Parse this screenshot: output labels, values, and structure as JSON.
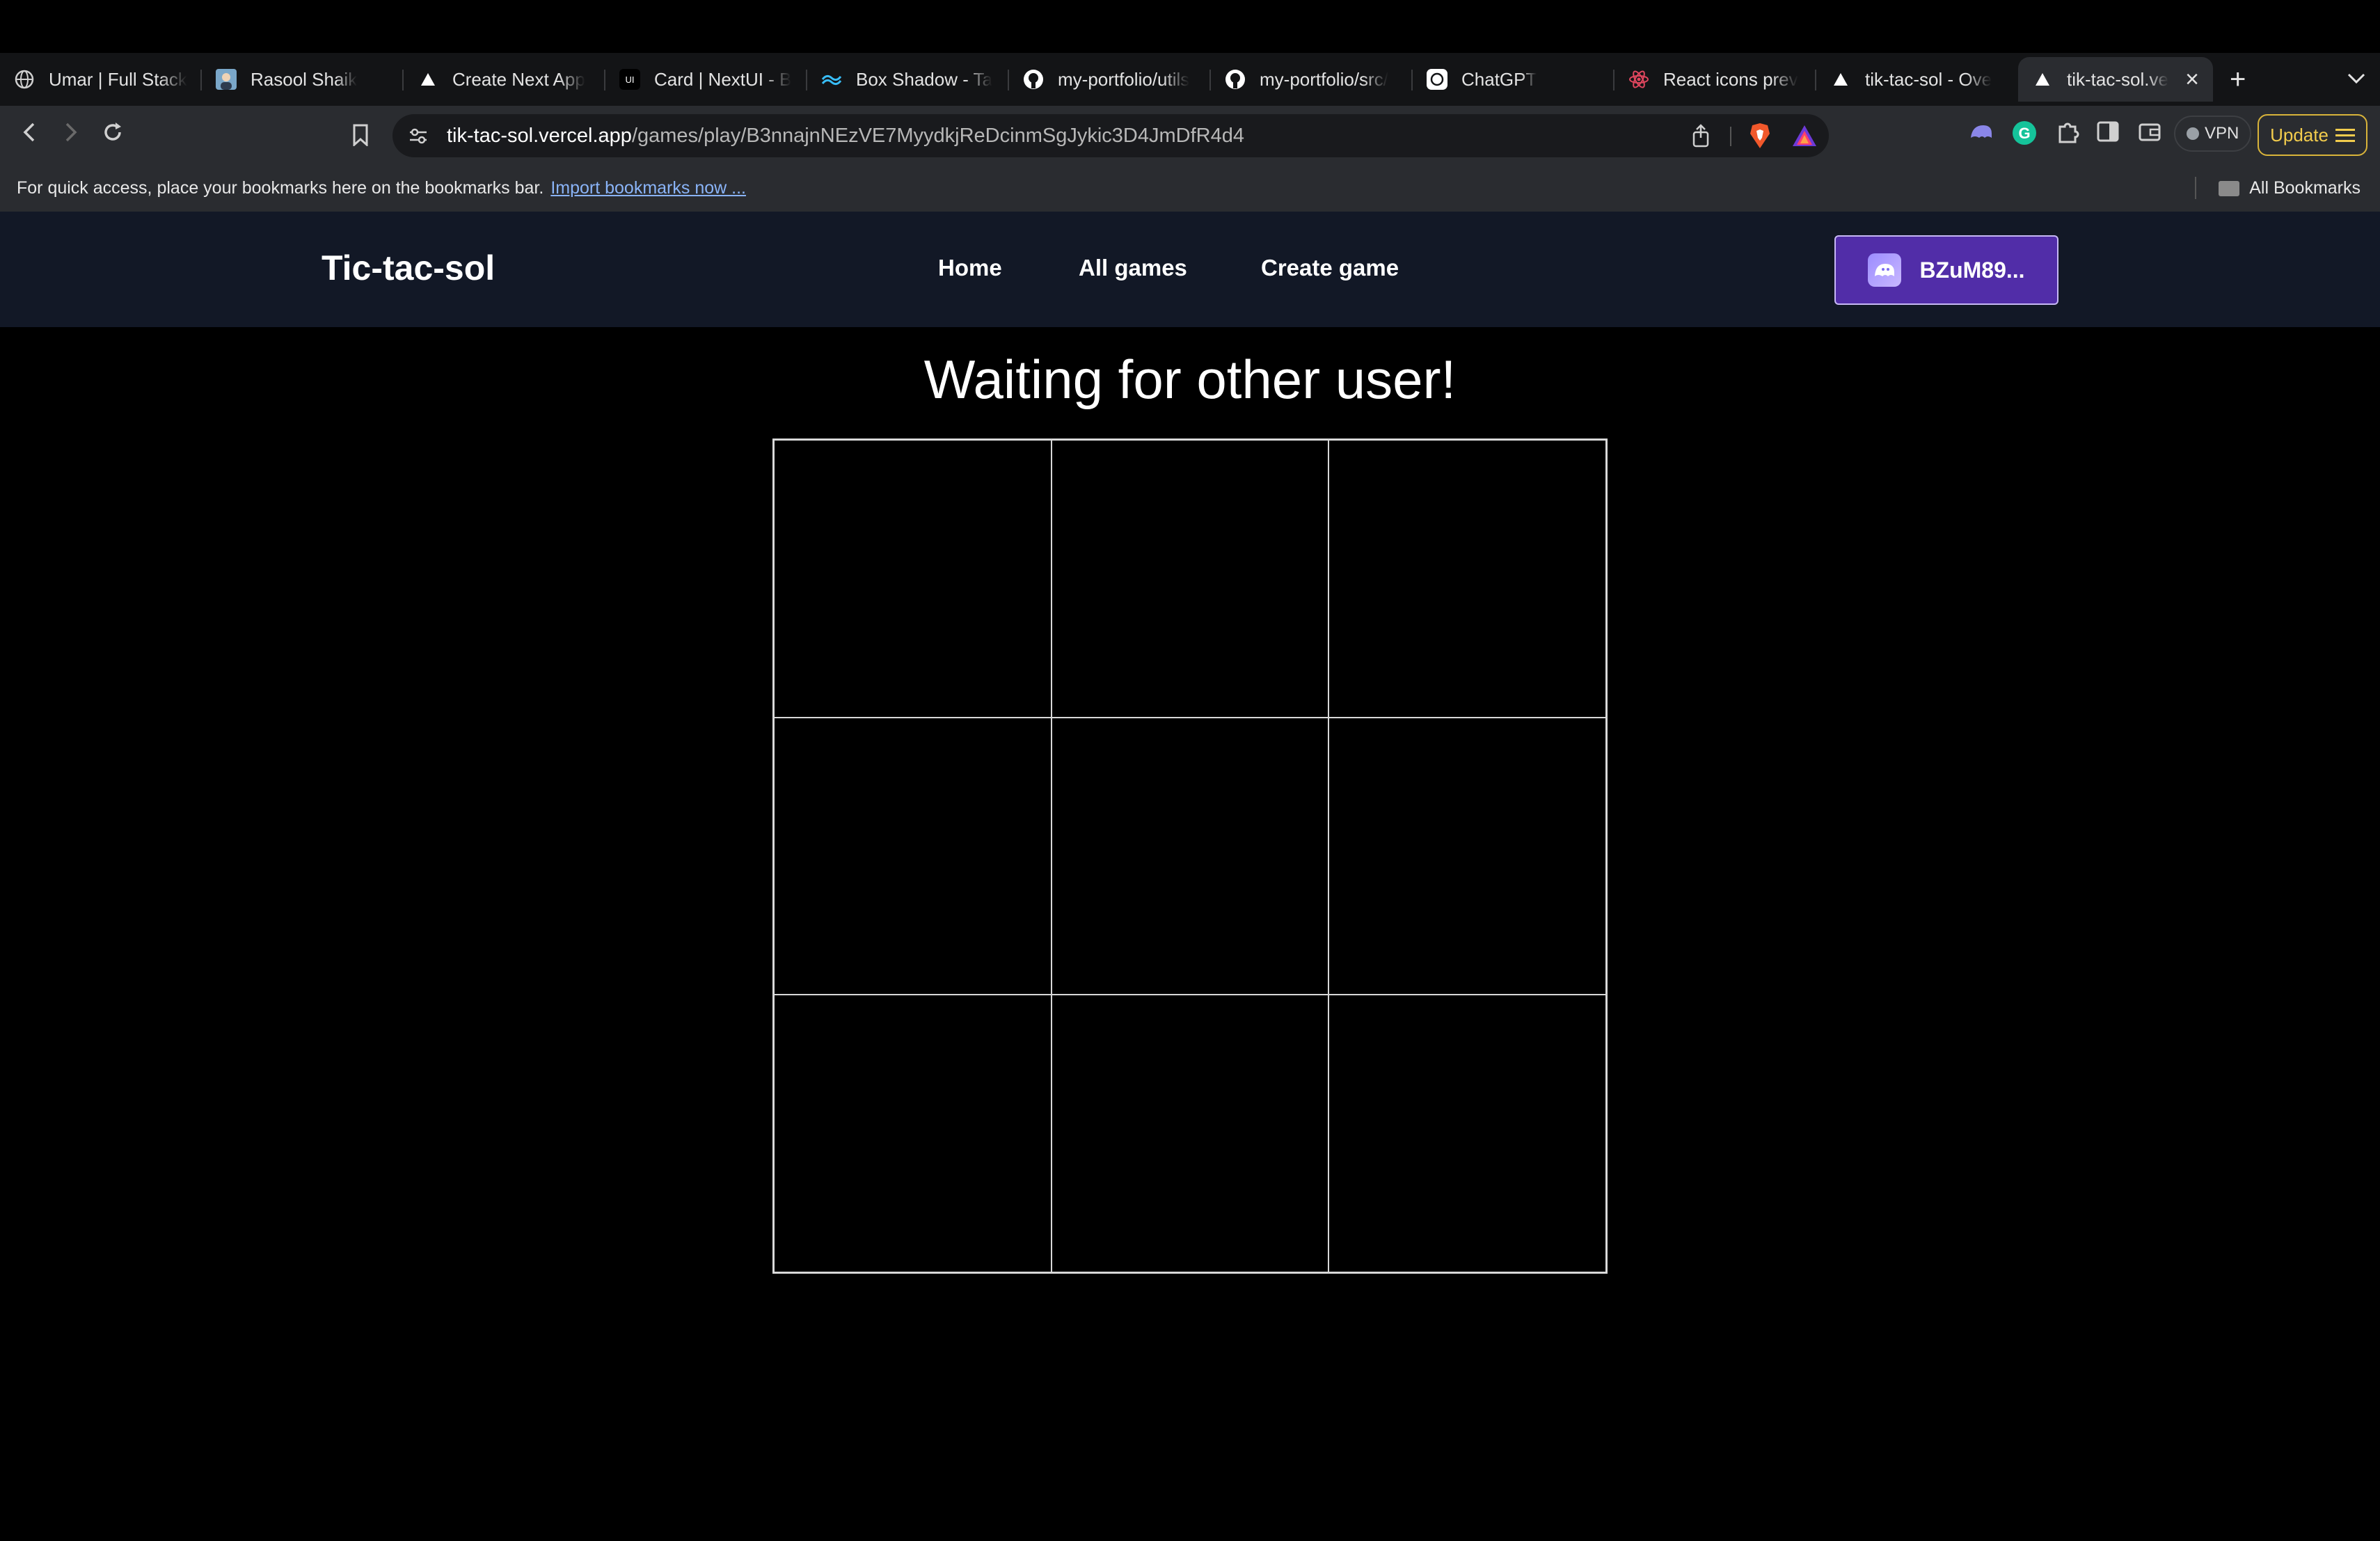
{
  "browser": {
    "tabs": [
      {
        "title": "Umar | Full Stack",
        "icon": "globe-icon"
      },
      {
        "title": "Rasool Shaik",
        "icon": "avatar-icon"
      },
      {
        "title": "Create Next App",
        "icon": "vercel-icon"
      },
      {
        "title": "Card | NextUI - B",
        "icon": "nextui-icon"
      },
      {
        "title": "Box Shadow - Ta",
        "icon": "tailwind-icon"
      },
      {
        "title": "my-portfolio/utils",
        "icon": "github-icon"
      },
      {
        "title": "my-portfolio/src/",
        "icon": "github-icon"
      },
      {
        "title": "ChatGPT",
        "icon": "chatgpt-icon"
      },
      {
        "title": "React icons prev",
        "icon": "react-icon"
      },
      {
        "title": "tik-tac-sol - Ove",
        "icon": "vercel-icon"
      }
    ],
    "active_tab": {
      "title": "tik-tac-sol.ve",
      "icon": "vercel-icon"
    },
    "url_host": "tik-tac-sol.vercel.app",
    "url_path": "/games/play/B3nnajnNEzVE7MyydkjReDcinmSgJykic3D4JmDfR4d4",
    "vpn_label": "VPN",
    "update_label": "Update",
    "bookmarks_text": "For quick access, place your bookmarks here on the bookmarks bar.",
    "bookmarks_link": "Import bookmarks now ...",
    "all_bookmarks": "All Bookmarks"
  },
  "site": {
    "logo": "Tic-tac-sol",
    "nav": [
      "Home",
      "All games",
      "Create game"
    ],
    "wallet_label": "BZuM89...",
    "colors": {
      "nav_bg": "#121826",
      "wallet_bg": "#512da8"
    }
  },
  "game": {
    "status": "Waiting for other user!",
    "board": [
      "",
      "",
      "",
      "",
      "",
      "",
      "",
      "",
      ""
    ]
  }
}
